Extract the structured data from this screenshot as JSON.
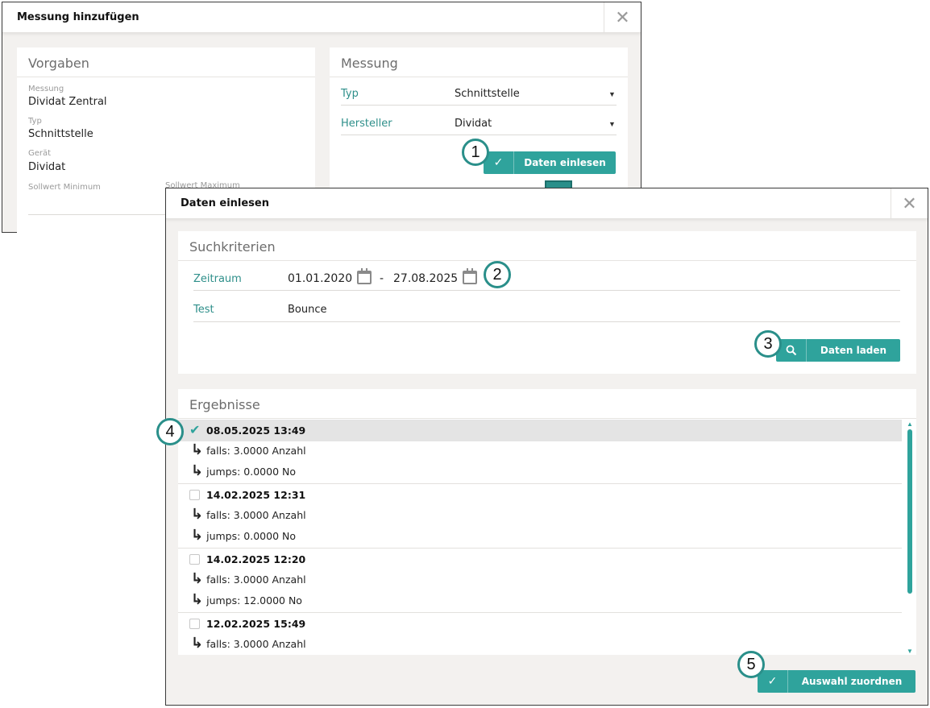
{
  "dialog1": {
    "title": "Messung hinzufügen",
    "close_glyph": "✕",
    "vorgaben": {
      "title": "Vorgaben",
      "fields": [
        {
          "label": "Messung",
          "value": "Dividat Zentral"
        },
        {
          "label": "Typ",
          "value": "Schnittstelle"
        },
        {
          "label": "Gerät",
          "value": "Dividat"
        }
      ],
      "sollwert_min_label": "Sollwert Minimum",
      "sollwert_max_label": "Sollwert Maximum"
    },
    "messung": {
      "title": "Messung",
      "typ_label": "Typ",
      "typ_value": "Schnittstelle",
      "hersteller_label": "Hersteller",
      "hersteller_value": "Dividat",
      "caret": "▼",
      "button_icon": "✓",
      "button_label": "Daten einlesen"
    }
  },
  "dialog2": {
    "title": "Daten einlesen",
    "close_glyph": "✕",
    "suchkriterien": {
      "title": "Suchkriterien",
      "zeitraum_label": "Zeitraum",
      "date_from": "01.01.2020",
      "date_separator": "-",
      "date_to": "27.08.2025",
      "test_label": "Test",
      "test_value": "Bounce",
      "button_icon": "🔍",
      "button_label": "Daten laden"
    },
    "ergebnisse": {
      "title": "Ergebnisse",
      "results": [
        {
          "datetime": "08.05.2025 13:49",
          "selected": true,
          "lines": [
            "falls: 3.0000 Anzahl",
            "jumps: 0.0000 No"
          ]
        },
        {
          "datetime": "14.02.2025 12:31",
          "selected": false,
          "lines": [
            "falls: 3.0000 Anzahl",
            "jumps: 0.0000 No"
          ]
        },
        {
          "datetime": "14.02.2025 12:20",
          "selected": false,
          "lines": [
            "falls: 3.0000 Anzahl",
            "jumps: 12.0000 No"
          ]
        },
        {
          "datetime": "12.02.2025 15:49",
          "selected": false,
          "lines": [
            "falls: 3.0000 Anzahl"
          ]
        }
      ],
      "check_glyph": "✔",
      "sub_arrow": "↳",
      "scroll_up": "▲",
      "scroll_down": "▼"
    },
    "assign_button_icon": "✓",
    "assign_button_label": "Auswahl zuordnen"
  },
  "annotations": [
    "1",
    "2",
    "3",
    "4",
    "5"
  ],
  "colors": {
    "accent": "#2fa39c",
    "accent_dark": "#2a8f8a",
    "dialog_bg": "#f3f1ef",
    "label_teal": "#2e8f8a"
  },
  "icons": {
    "close": "close-icon",
    "calendar": "calendar-icon",
    "search": "search-icon",
    "check": "check-icon",
    "arrow": "down-arrow-icon"
  }
}
